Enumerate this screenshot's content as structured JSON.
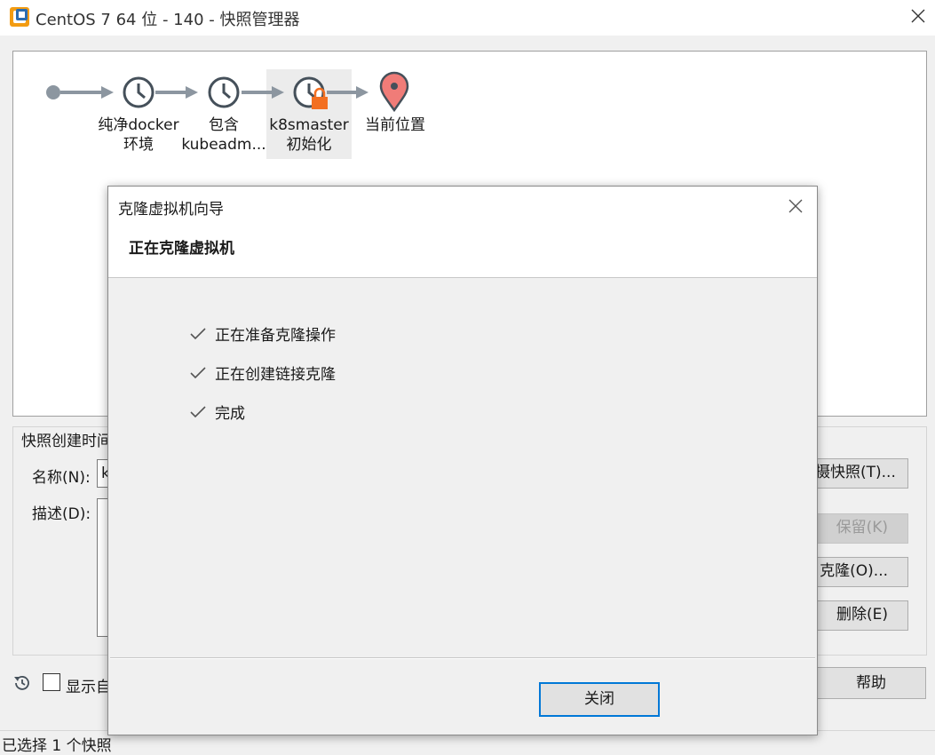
{
  "window": {
    "title": "CentOS 7 64 位 - 140 - 快照管理器",
    "app_icon": "vmware-icon",
    "close_icon": "close-icon"
  },
  "snapshot_tree": {
    "nodes": [
      {
        "line1": "纯净docker",
        "line2": "环境",
        "icon": "clock-icon"
      },
      {
        "line1": "包含",
        "line2": "kubeadm...",
        "icon": "clock-icon"
      },
      {
        "line1": "k8smaster",
        "line2": "初始化",
        "icon": "clock-lock-icon",
        "selected": true
      },
      {
        "line1": "当前位置",
        "line2": "",
        "icon": "location-pin-icon"
      }
    ]
  },
  "details": {
    "group_title": "快照创建时间",
    "name_label": "名称(N):",
    "name_value": "k",
    "description_label": "描述(D):"
  },
  "actions": {
    "take_snapshot": "拍摄快照(T)...",
    "keep": "保留(K)",
    "clone": "克隆(O)...",
    "delete": "删除(E)",
    "help": "帮助"
  },
  "show_auto_label": "显示自",
  "status": "已选择 1 个快照",
  "dialog": {
    "title": "克隆虚拟机向导",
    "heading": "正在克隆虚拟机",
    "steps": [
      "正在准备克隆操作",
      "正在创建链接克隆",
      "完成"
    ],
    "close_button": "关闭"
  },
  "colors": {
    "accent": "#0078d7",
    "arrow": "#8c96a0",
    "lock": "#f36f21",
    "pin": "#f07c78"
  }
}
